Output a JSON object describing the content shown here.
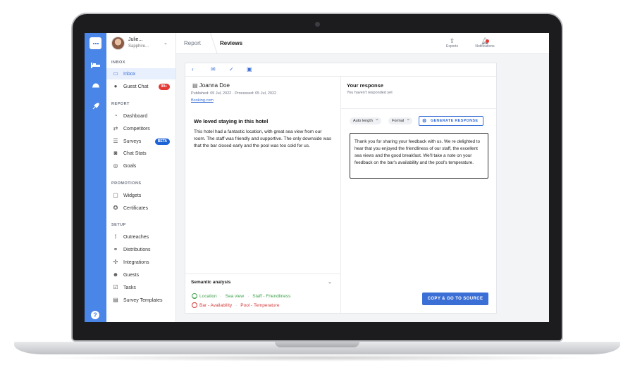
{
  "user": {
    "name": "Julie...",
    "hotel": "Sapphire..."
  },
  "sidebar": {
    "sections": [
      {
        "title": "INBOX",
        "items": [
          {
            "label": "Inbox",
            "icon": "inbox-icon",
            "active": true
          },
          {
            "label": "Guest Chat",
            "icon": "chat-icon",
            "badge": "99+"
          }
        ]
      },
      {
        "title": "REPORT",
        "items": [
          {
            "label": "Dashboard",
            "icon": "dashboard-icon"
          },
          {
            "label": "Competitors",
            "icon": "competitors-icon"
          },
          {
            "label": "Surveys",
            "icon": "surveys-icon",
            "badge": "BETA"
          },
          {
            "label": "Chat Stats",
            "icon": "chat-stats-icon"
          },
          {
            "label": "Goals",
            "icon": "goals-icon"
          }
        ]
      },
      {
        "title": "PROMOTIONS",
        "items": [
          {
            "label": "Widgets",
            "icon": "widgets-icon"
          },
          {
            "label": "Certificates",
            "icon": "certificates-icon"
          }
        ]
      },
      {
        "title": "SETUP",
        "items": [
          {
            "label": "Outreaches",
            "icon": "outreaches-icon"
          },
          {
            "label": "Distributions",
            "icon": "distributions-icon"
          },
          {
            "label": "Integrations",
            "icon": "integrations-icon"
          },
          {
            "label": "Guests",
            "icon": "guests-icon"
          },
          {
            "label": "Tasks",
            "icon": "tasks-icon"
          },
          {
            "label": "Survey Templates",
            "icon": "survey-templates-icon"
          }
        ]
      }
    ]
  },
  "topbar": {
    "crumb_report": "Report",
    "crumb_reviews": "Reviews",
    "exports_label": "Exports",
    "notifications_label": "Notifications"
  },
  "review": {
    "reviewer": "Joanna Doe",
    "meta": "Published: 05 Jul, 2022  ·  Processed: 05 Jul, 2022",
    "source": "Booking.com",
    "title": "We loved staying in this hotel",
    "body": "This hotel had a fantastic location, with great sea view from our room. The staff was friendly and supportive. The only downside was that the bar closed early and the pool was too cold for us."
  },
  "semantic": {
    "title": "Semantic analysis",
    "positive": [
      "Location",
      "Sea view",
      "Staff - Friendliness"
    ],
    "negative": [
      "Bar - Availability",
      "Pool - Temperature"
    ]
  },
  "response": {
    "title": "Your response",
    "subtitle": "You haven't responded yet",
    "length_chip": "Auto length",
    "tone_chip": "Formal",
    "generate_label": "GENERATE RESPONSE",
    "text": "Thank you for sharing your feedback with us. We re delighted to hear that you enjoyed the friendliness of our staff, the excellent sea views and the good breakfast. We'll take a note on your feedback on the bar's availability and the pool's temperature.",
    "copy_label": "COPY & GO TO SOURCE"
  },
  "colors": {
    "brand": "#4a86e8",
    "accent": "#3b6fd6",
    "positive": "#3ca04a",
    "negative": "#d63b3b",
    "badge_red": "#e53935"
  }
}
